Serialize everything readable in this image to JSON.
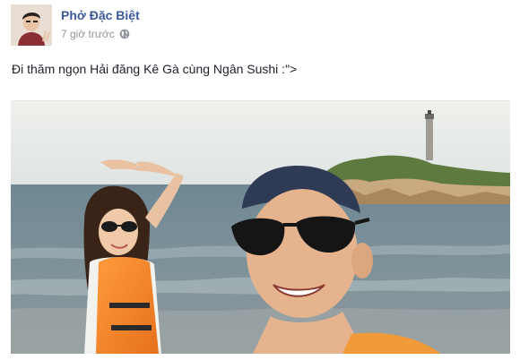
{
  "post": {
    "author_name": "Phở Đặc Biệt",
    "timestamp": "7 giờ trước",
    "privacy_icon": "globe-icon",
    "text": "Đi thăm ngọn Hải đăng Kê Gà cùng Ngân Sushi :\">"
  },
  "colors": {
    "author_link": "#3b5998",
    "meta_text": "#90949c",
    "body_text": "#1d2129"
  }
}
